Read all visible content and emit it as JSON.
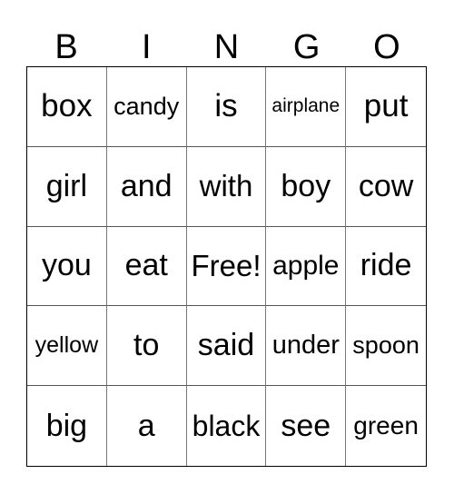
{
  "header": [
    "B",
    "I",
    "N",
    "G",
    "O"
  ],
  "cells": [
    {
      "text": "box",
      "size": "big"
    },
    {
      "text": "candy",
      "size": "mid"
    },
    {
      "text": "is",
      "size": "big"
    },
    {
      "text": "airplane",
      "size": "small"
    },
    {
      "text": "put",
      "size": "big"
    },
    {
      "text": "girl",
      "size": "big"
    },
    {
      "text": "and",
      "size": "big"
    },
    {
      "text": "with",
      "size": "big"
    },
    {
      "text": "boy",
      "size": "big"
    },
    {
      "text": "cow",
      "size": "big"
    },
    {
      "text": "you",
      "size": "big"
    },
    {
      "text": "eat",
      "size": "big"
    },
    {
      "text": "Free!",
      "size": "big"
    },
    {
      "text": "apple",
      "size": "mid"
    },
    {
      "text": "ride",
      "size": "big"
    },
    {
      "text": "yellow",
      "size": "mid"
    },
    {
      "text": "to",
      "size": "big"
    },
    {
      "text": "said",
      "size": "big"
    },
    {
      "text": "under",
      "size": "mid"
    },
    {
      "text": "spoon",
      "size": "mid"
    },
    {
      "text": "big",
      "size": "big"
    },
    {
      "text": "a",
      "size": "big"
    },
    {
      "text": "black",
      "size": "big"
    },
    {
      "text": "see",
      "size": "big"
    },
    {
      "text": "green",
      "size": "mid"
    }
  ]
}
